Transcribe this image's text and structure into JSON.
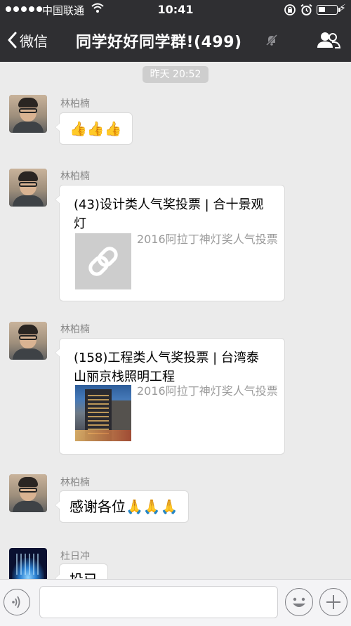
{
  "status_bar": {
    "carrier": "中国联通",
    "time": "10:41"
  },
  "nav": {
    "back_label": "微信",
    "title": "同学好好同学群!(499)",
    "icons": [
      "chevron-left-icon",
      "mute-icon",
      "members-icon"
    ]
  },
  "chat": {
    "timestamp": "昨天 20:52",
    "messages": [
      {
        "sender": "林柏楠",
        "type": "text",
        "text": "👍👍👍"
      },
      {
        "sender": "林柏楠",
        "type": "link-card",
        "title": "(43)设计类人气奖投票 | 合十景观灯",
        "source": "2016阿拉丁神灯奖人气投票",
        "thumbnail": "link-icon"
      },
      {
        "sender": "林柏楠",
        "type": "link-card",
        "title": "(158)工程类人气奖投票 | 台湾泰山丽京栈照明工程",
        "source": "2016阿拉丁神灯奖人气投票",
        "thumbnail": "hotel-photo"
      },
      {
        "sender": "林柏楠",
        "type": "text",
        "text": "感谢各位🙏🙏🙏"
      },
      {
        "sender": "杜日冲",
        "type": "text",
        "text": "投已"
      }
    ]
  },
  "input_bar": {
    "value": "",
    "icons": [
      "voice-icon",
      "emoji-icon",
      "plus-icon"
    ]
  },
  "colors": {
    "nav_bg": "#2f2f32",
    "chat_bg": "#ebebeb",
    "bubble_bg": "#ffffff",
    "timestamp_pill": "#cecece"
  }
}
